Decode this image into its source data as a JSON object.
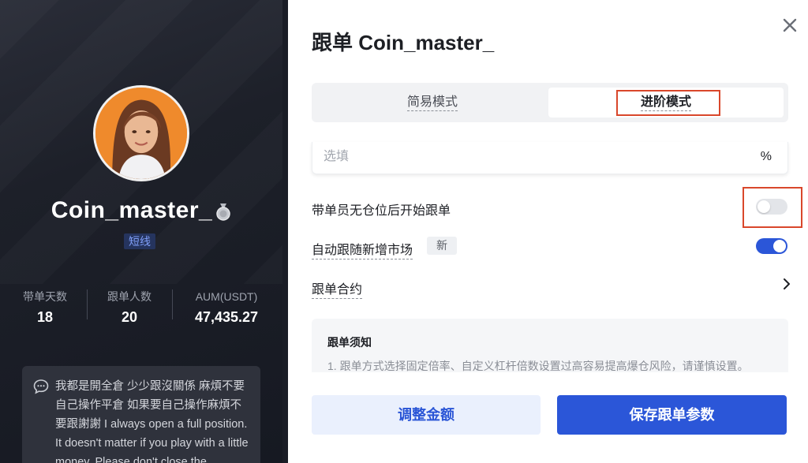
{
  "profile": {
    "name": "Coin_master_",
    "tag": "短线",
    "stats": [
      {
        "label": "带单天数",
        "value": "18"
      },
      {
        "label": "跟单人数",
        "value": "20"
      },
      {
        "label": "AUM(USDT)",
        "value": "47,435.27"
      }
    ],
    "bio": "我都是開全倉 少少跟沒關係 麻煩不要自己操作平倉 如果要自己操作麻煩不要跟謝謝 I always open a full position. It doesn't matter if you play with a little money. Please don't close the"
  },
  "modal": {
    "title": "跟单 Coin_master_",
    "tabs": {
      "simple": "简易模式",
      "advanced": "进阶模式",
      "active": "advanced"
    },
    "input": {
      "placeholder": "选填",
      "value": "",
      "unit": "%"
    },
    "settings": [
      {
        "label": "带单员无仓位后开始跟单",
        "enabled": false
      },
      {
        "label": "自动跟随新增市场",
        "badge": "新",
        "enabled": true
      }
    ],
    "contract_label": "跟单合约",
    "notice": {
      "title": "跟单须知",
      "text": "1. 跟单方式选择固定倍率、自定义杠杆倍数设置过高容易提高爆仓风险，请谨慎设置。"
    },
    "buttons": {
      "adjust": "调整金额",
      "save": "保存跟单参数"
    },
    "colors": {
      "primary": "#2b56d8",
      "highlight": "#d9472b"
    }
  }
}
